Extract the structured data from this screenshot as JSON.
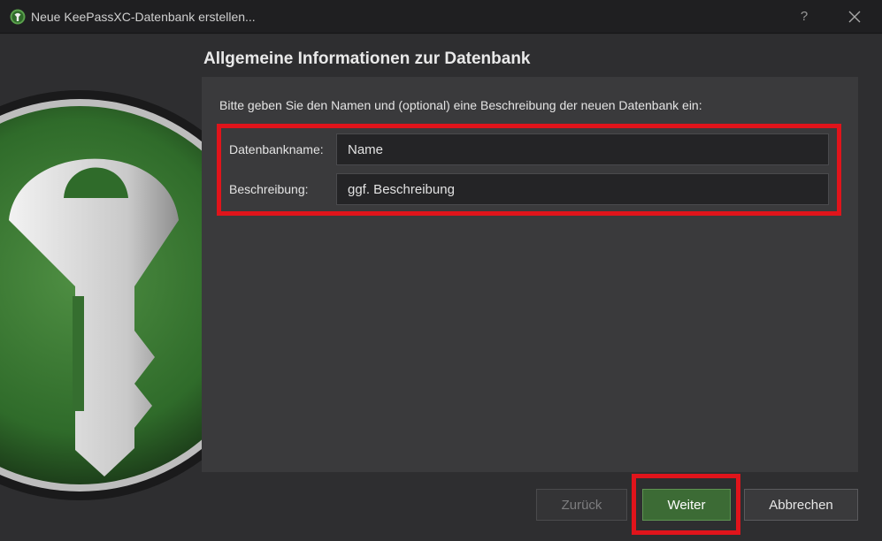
{
  "window": {
    "title": "Neue KeePassXC-Datenbank erstellen...",
    "help_label": "?",
    "app_icon": "keepassxc-logo-icon",
    "close_icon": "close-icon"
  },
  "page": {
    "heading": "Allgemeine Informationen zur Datenbank",
    "intro": "Bitte geben Sie den Namen und (optional) eine Beschreibung der neuen Datenbank ein:"
  },
  "form": {
    "name_label": "Datenbankname:",
    "name_placeholder": "Name",
    "description_label": "Beschreibung:",
    "description_placeholder": "ggf. Beschreibung"
  },
  "buttons": {
    "back": "Zurück",
    "next": "Weiter",
    "cancel": "Abbrechen"
  },
  "colors": {
    "accent_green": "#3c6b35",
    "highlight_red": "#e0141b",
    "background": "#2e2e30"
  }
}
